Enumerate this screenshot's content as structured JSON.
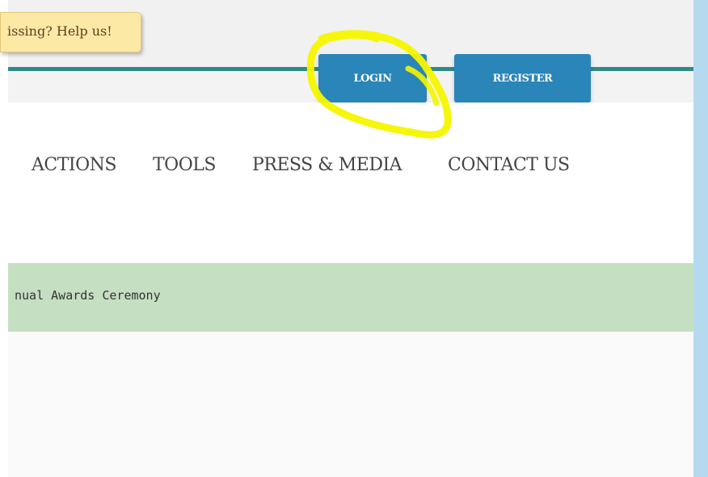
{
  "help_note": {
    "text": "issing? Help us!"
  },
  "header": {
    "login_label": "LOGIN",
    "register_label": "REGISTER"
  },
  "nav": {
    "items": [
      {
        "label": "ACTIONS"
      },
      {
        "label": "TOOLS"
      },
      {
        "label": "PRESS & MEDIA"
      },
      {
        "label": "CONTACT US"
      }
    ]
  },
  "banner": {
    "text": "nual Awards Ceremony"
  },
  "colors": {
    "accent_teal": "#2e8a86",
    "button_blue": "#2a85b8",
    "banner_green": "#c5dfc3",
    "note_yellow": "#fde9a6",
    "highlight_yellow": "#f5f500",
    "side_bar_blue": "#b5daf0"
  }
}
